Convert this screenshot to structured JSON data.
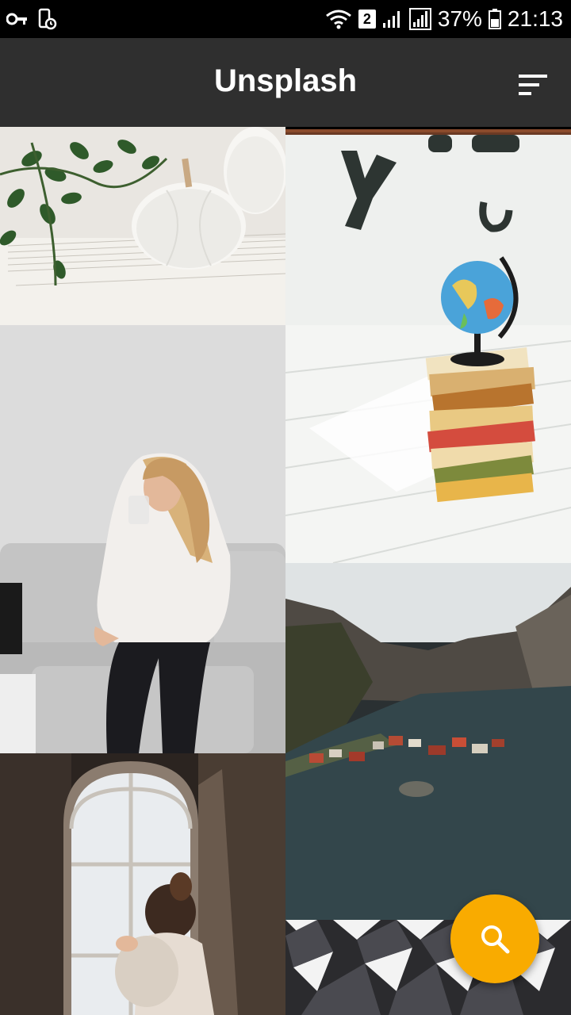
{
  "status_bar": {
    "sim_badge": "2",
    "battery_percent": "37%",
    "time": "21:13",
    "icons": [
      "key-icon",
      "phone-clock-icon",
      "wifi-icon",
      "sim-badge-icon",
      "signal-icon",
      "signal-icon-2",
      "battery-icon"
    ]
  },
  "app_bar": {
    "title": "Unsplash",
    "sort_icon": "sort-icon"
  },
  "photos": [
    {
      "id": "photo-pumpkins",
      "subject": "white pumpkins with greenery"
    },
    {
      "id": "photo-globe-books",
      "subject": "globe on stack of books"
    },
    {
      "id": "photo-woman-sofa",
      "subject": "woman drinking on sofa"
    },
    {
      "id": "photo-fjord-village",
      "subject": "fjord village aerial"
    },
    {
      "id": "photo-girl-window",
      "subject": "girl at arched window"
    },
    {
      "id": "photo-geometric",
      "subject": "geometric black and white pattern"
    }
  ],
  "fab": {
    "icon": "search-icon",
    "color": "#f9ab00"
  },
  "colors": {
    "app_bar": "#2f2f2f",
    "status_bar": "#000000"
  }
}
